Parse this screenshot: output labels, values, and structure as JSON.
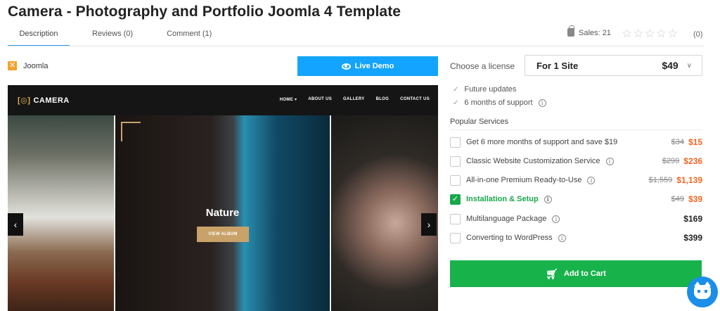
{
  "product": {
    "title": "Camera - Photography and Portfolio Joomla 4 Template",
    "platform": "Joomla"
  },
  "tabs": [
    {
      "label": "Description",
      "active": true
    },
    {
      "label": "Reviews (0)",
      "active": false
    },
    {
      "label": "Comment (1)",
      "active": false
    }
  ],
  "stats": {
    "sales_label": "Sales:",
    "sales_count": "21",
    "stars": "☆☆☆☆☆",
    "rating_count": "(0)"
  },
  "live_demo_label": "Live Demo",
  "preview": {
    "logo": "CAMERA",
    "logo_mark": "[◎]",
    "nav": [
      "HOME ▾",
      "ABOUT US",
      "GALLERY",
      "BLOG",
      "CONTACT US"
    ],
    "caption": "Nature",
    "button": "VIEW ALBUM",
    "prev": "‹",
    "next": "›"
  },
  "license": {
    "label": "Choose a license",
    "selected": "For 1 Site",
    "price": "$49",
    "chevron": "∨"
  },
  "features": [
    {
      "label": "Future updates",
      "info": false
    },
    {
      "label": "6 months of support",
      "info": true
    }
  ],
  "services": {
    "heading": "Popular Services",
    "items": [
      {
        "label": "Get 6 more months of support and save $19",
        "info": false,
        "old": "$34",
        "new": "$15",
        "checked": false
      },
      {
        "label": "Classic Website Customization Service",
        "info": true,
        "old": "$299",
        "new": "$236",
        "checked": false
      },
      {
        "label": "All-in-one Premium Ready-to-Use",
        "info": true,
        "old": "$1,559",
        "new": "$1,139",
        "checked": false
      },
      {
        "label": "Installation & Setup",
        "info": true,
        "old": "$49",
        "new": "$39",
        "checked": true
      },
      {
        "label": "Multilanguage Package",
        "info": true,
        "old": "",
        "new": "$169",
        "checked": false
      },
      {
        "label": "Converting to WordPress",
        "info": true,
        "old": "",
        "new": "$399",
        "checked": false
      }
    ]
  },
  "cart_label": "Add to Cart",
  "colors": {
    "accent_blue": "#13a4ff",
    "green": "#18b24b",
    "sale_orange": "#f26522"
  }
}
